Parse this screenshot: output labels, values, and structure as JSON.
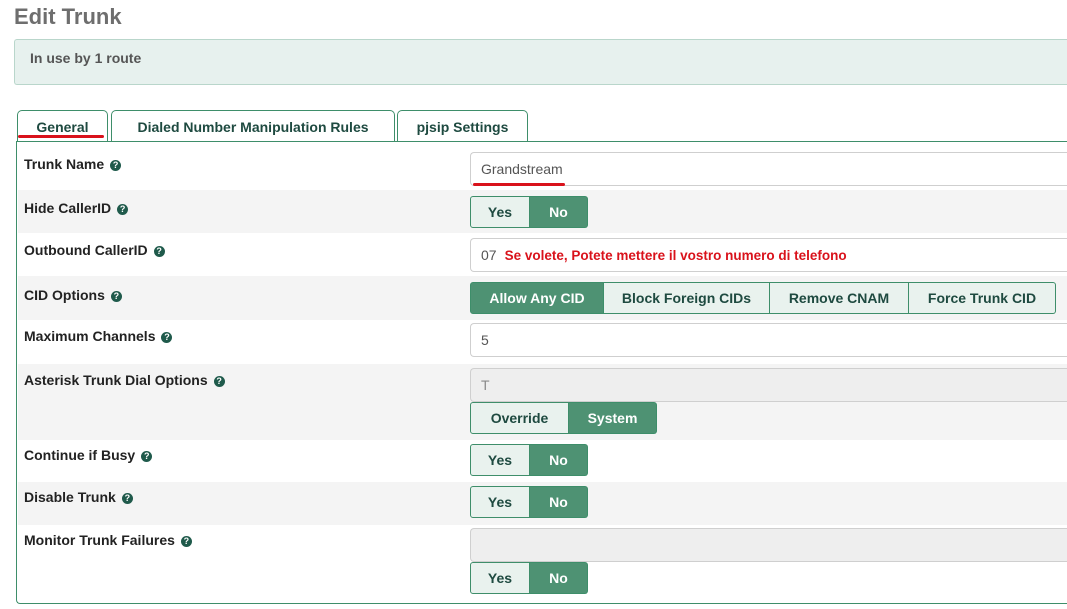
{
  "page": {
    "title": "Edit Trunk"
  },
  "alert": {
    "text": "In use by 1 route"
  },
  "tabs": [
    {
      "label": "General",
      "active": true
    },
    {
      "label": "Dialed Number Manipulation Rules",
      "active": false
    },
    {
      "label": "pjsip Settings",
      "active": false
    }
  ],
  "icons": {
    "help": "help-circle-icon",
    "help_glyph": "?"
  },
  "colors": {
    "accent": "#4e9273",
    "accent_border": "#3e8e6a",
    "annotation": "#d9121b"
  },
  "form": {
    "trunk_name": {
      "label": "Trunk Name",
      "value": "Grandstream"
    },
    "hide_callerid": {
      "label": "Hide CallerID",
      "options": [
        "Yes",
        "No"
      ],
      "selected": "No"
    },
    "outbound_callerid": {
      "label": "Outbound CallerID",
      "value": "07",
      "annotation": "Se volete, Potete mettere il vostro numero di telefono"
    },
    "cid_options": {
      "label": "CID Options",
      "options": [
        "Allow Any CID",
        "Block Foreign CIDs",
        "Remove CNAM",
        "Force Trunk CID"
      ],
      "selected": "Allow Any CID"
    },
    "max_channels": {
      "label": "Maximum Channels",
      "value": "5"
    },
    "dial_options": {
      "label": "Asterisk Trunk Dial Options",
      "value": "T",
      "options": [
        "Override",
        "System"
      ],
      "selected": "System"
    },
    "continue_if_busy": {
      "label": "Continue if Busy",
      "options": [
        "Yes",
        "No"
      ],
      "selected": "No"
    },
    "disable_trunk": {
      "label": "Disable Trunk",
      "options": [
        "Yes",
        "No"
      ],
      "selected": "No"
    },
    "monitor_failures": {
      "label": "Monitor Trunk Failures",
      "value": "",
      "options": [
        "Yes",
        "No"
      ],
      "selected": "No"
    }
  }
}
